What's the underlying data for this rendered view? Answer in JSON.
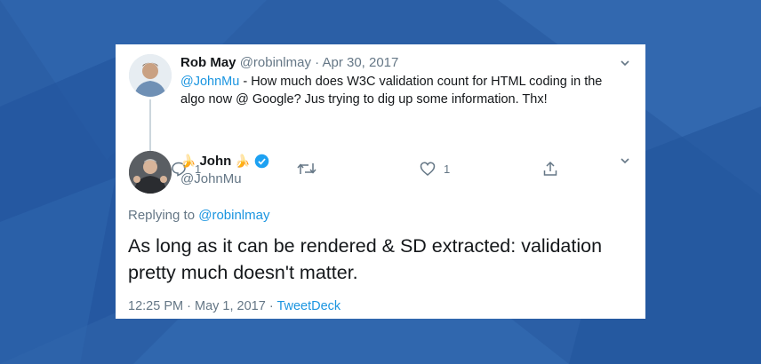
{
  "colors": {
    "accent": "#1b95e0",
    "text": "#14171a",
    "muted": "#657786",
    "verified": "#1da1f2",
    "background": "#2b5fa6"
  },
  "reply_tweet": {
    "author_name": "Rob May",
    "author_handle": "@robinlmay",
    "separator": "·",
    "date": "Apr 30, 2017",
    "mention": "@JohnMu",
    "text": " - How much does W3C validation count for HTML coding in the algo now @ Google? Jus trying to dig up some information. Thx!",
    "reply_count": "1",
    "like_count": "1",
    "icons": [
      "reply-icon",
      "retweet-icon",
      "like-icon",
      "share-icon",
      "chevron-down-icon"
    ]
  },
  "main_tweet": {
    "author_name": "John",
    "author_emoji": "🍌",
    "author_handle": "@JohnMu",
    "replying_prefix": "Replying to",
    "replying_to": "@robinlmay",
    "text": "As long as it can be rendered & SD extracted: validation pretty much doesn't matter.",
    "time": "12:25 PM",
    "date": "May 1, 2017",
    "separator": "·",
    "source": "TweetDeck",
    "icons": [
      "verified-badge-icon",
      "chevron-down-icon"
    ]
  }
}
